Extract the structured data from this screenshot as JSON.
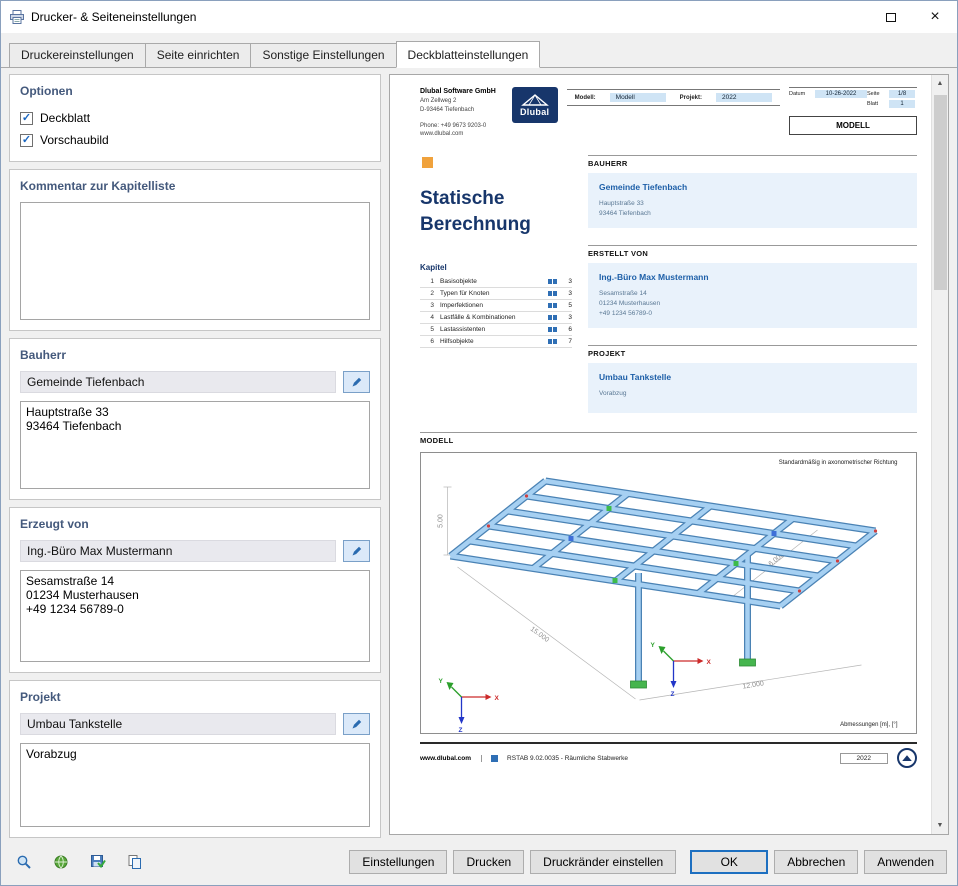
{
  "window": {
    "title": "Drucker- & Seiteneinstellungen"
  },
  "icons": {
    "close": "×",
    "scroll_up": "▲",
    "scroll_down": "▼",
    "check": "✓"
  },
  "tabs": [
    {
      "label": "Druckereinstellungen",
      "active": false
    },
    {
      "label": "Seite einrichten",
      "active": false
    },
    {
      "label": "Sonstige Einstellungen",
      "active": false
    },
    {
      "label": "Deckblatteinstellungen",
      "active": true
    }
  ],
  "left_panel": {
    "options": {
      "title": "Optionen",
      "deckblatt": {
        "label": "Deckblatt",
        "checked": true
      },
      "vorschaubild": {
        "label": "Vorschaubild",
        "checked": true
      }
    },
    "kommentar": {
      "title": "Kommentar zur Kapitelliste",
      "value": ""
    },
    "bauherr": {
      "title": "Bauherr",
      "name": "Gemeinde Tiefenbach",
      "address": "Hauptstraße 33\n93464 Tiefenbach"
    },
    "erzeugt_von": {
      "title": "Erzeugt von",
      "name": "Ing.-Büro Max Mustermann",
      "address": "Sesamstraße 14\n01234 Musterhausen\n+49 1234 56789-0"
    },
    "projekt": {
      "title": "Projekt",
      "name": "Umbau Tankstelle",
      "note": "Vorabzug"
    }
  },
  "preview": {
    "company": {
      "name": "Dlubal Software GmbH",
      "address_line1": "Am Zellweg 2",
      "address_line2": "D-93464 Tiefenbach",
      "phone": "Phone: +49 9673 9203-0",
      "website": "www.dlubal.com"
    },
    "logo_text": "Dlubal",
    "header": {
      "model_label": "Modell:",
      "model_value": "Modell",
      "project_label": "Projekt:",
      "project_value": "2022",
      "date_label": "Datum",
      "date_value": "10-26-2022",
      "page_label": "Seite",
      "page_value": "1/8",
      "sheet_label": "Blatt",
      "sheet_value": "1",
      "doc_type": "MODELL"
    },
    "title_line1": "Statische",
    "title_line2": "Berechnung",
    "kapitel": {
      "title": "Kapitel",
      "rows": [
        {
          "num": "1",
          "name": "Basisobjekte",
          "page": "3"
        },
        {
          "num": "2",
          "name": "Typen für Knoten",
          "page": "3"
        },
        {
          "num": "3",
          "name": "Imperfektionen",
          "page": "5"
        },
        {
          "num": "4",
          "name": "Lastfälle & Kombinationen",
          "page": "3"
        },
        {
          "num": "5",
          "name": "Lastassistenten",
          "page": "6"
        },
        {
          "num": "6",
          "name": "Hilfsobjekte",
          "page": "7"
        }
      ]
    },
    "sections": [
      {
        "header": "BAUHERR",
        "name": "Gemeinde Tiefenbach",
        "lines": [
          "Hauptstraße 33",
          "93464 Tiefenbach"
        ]
      },
      {
        "header": "ERSTELLT VON",
        "name": "Ing.-Büro Max Mustermann",
        "lines": [
          "Sesamstraße 14",
          "01234 Musterhausen",
          "+49 1234 56789-0"
        ]
      },
      {
        "header": "PROJEKT",
        "name": "Umbau Tankstelle",
        "lines": [
          "Vorabzug"
        ]
      }
    ],
    "modell": {
      "header": "MODELL",
      "annotation_top": "Standardmäßig in axonometrischer Richtung",
      "annotation_bottom": "Abmessungen [m], [°]",
      "dim_height": "5.00",
      "dim_length": "15.000",
      "dim_width": "12.000",
      "dim_depth": "6.000",
      "axis_x": "X",
      "axis_y": "Y",
      "axis_z": "Z"
    },
    "page_footer": {
      "website": "www.dlubal.com",
      "program": "RSTAB 9.02.0035 - Räumliche Stabwerke",
      "year": "2022"
    }
  },
  "footer": {
    "buttons": [
      {
        "label": "Einstellungen"
      },
      {
        "label": "Drucken"
      },
      {
        "label": "Druckränder einstellen"
      },
      {
        "label": "OK"
      },
      {
        "label": "Abbrechen"
      },
      {
        "label": "Anwenden"
      }
    ]
  }
}
